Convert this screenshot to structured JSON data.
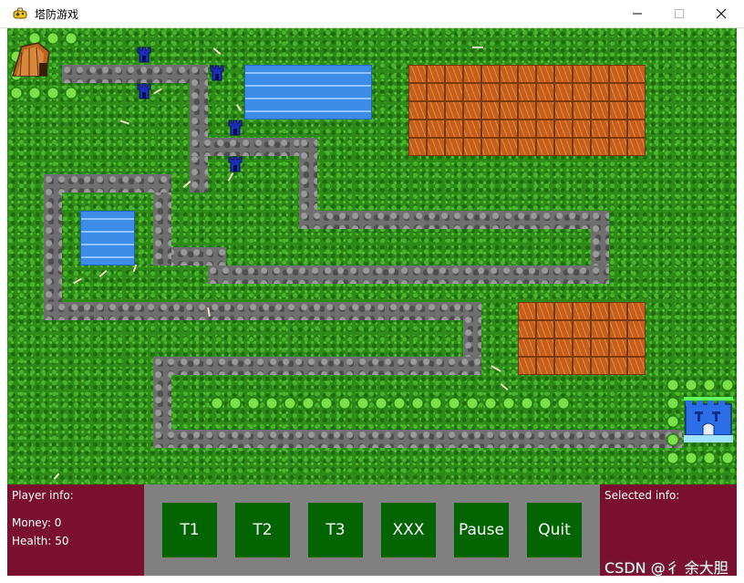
{
  "window": {
    "title": "塔防游戏"
  },
  "icons": {
    "app": "game-controller-icon",
    "minimize": "minimize-icon",
    "maximize": "maximize-icon",
    "close": "close-icon",
    "tower": "tower-icon",
    "hut": "enemy-spawn-hut-icon",
    "castle": "home-castle-icon"
  },
  "panel": {
    "player_info_label": "Player info:",
    "money": "Money: 0",
    "health": "Health: 50",
    "selected_info_label": "Selected info:"
  },
  "buttons": [
    "T1",
    "T2",
    "T3",
    "XXX",
    "Pause",
    "Quit"
  ],
  "watermark": "CSDN @彳 余大胆",
  "colors": {
    "panel_side": "#7a1030",
    "panel_middle": "#808080",
    "button": "#006400"
  }
}
